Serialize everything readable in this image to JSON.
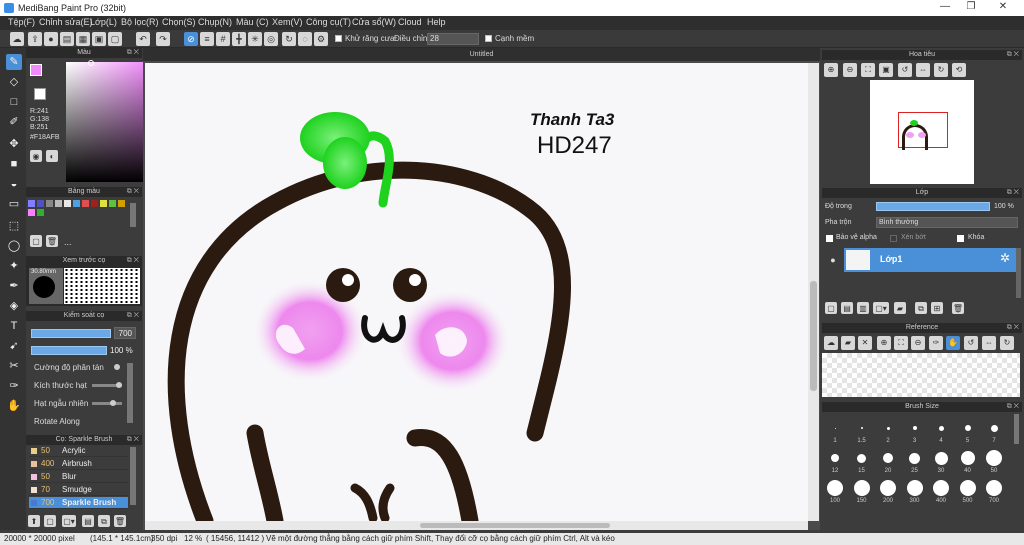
{
  "window": {
    "title": "MediBang Paint Pro (32bit)",
    "minimize": "—",
    "maximize": "❐",
    "close": "✕"
  },
  "menu": [
    "Tệp(F)",
    "Chỉnh sửa(E)",
    "Lớp(L)",
    "Bộ lọc(R)",
    "Chọn(S)",
    "Chụp(N)",
    "Màu (C)",
    "Xem(V)",
    "Công cụ(T)",
    "Cửa sổ(W)",
    "Cloud",
    "Help"
  ],
  "toolbar": {
    "antialias_label": "Khử răng cưa",
    "adjust_label": "Điều chỉnh",
    "adjust_value": "28",
    "edge_label": "Cạnh mềm"
  },
  "color_panel": {
    "title": "Màu",
    "r": "R:241",
    "g": "G:138",
    "b": "B:251",
    "hex": "#F18AFB",
    "fg": "#f18afb",
    "bg": "#ffffff"
  },
  "palette_panel": {
    "title": "Bảng màu",
    "colors": [
      "#7f7fff",
      "#5050c0",
      "#888888",
      "#bbbbbb",
      "#e8e8e8",
      "#50a0e0",
      "#e05050",
      "#a02020",
      "#e0e040",
      "#60c040",
      "#d0a000",
      "#ff80ff",
      "#30b030"
    ],
    "more": "..."
  },
  "preview_panel": {
    "title": "Xem trước cọ",
    "size": "30.80mm"
  },
  "brush_control": {
    "title": "Kiểm soát cọ",
    "size_value": "700",
    "opacity_value": "100 %",
    "props": [
      "Cường độ phân tán",
      "Kích thước hạt",
      "Hạt ngẫu nhiên",
      "Rotate Along"
    ]
  },
  "brush_list": {
    "title": "Cọ: Sparkle Brush",
    "items": [
      {
        "size": "50",
        "name": "Acrylic",
        "color": "#e8d088"
      },
      {
        "size": "400",
        "name": "Airbrush",
        "color": "#e8c0a0"
      },
      {
        "size": "50",
        "name": "Blur",
        "color": "#f0c0e0"
      },
      {
        "size": "70",
        "name": "Smudge",
        "color": "#f0e0d0"
      },
      {
        "size": "700",
        "name": "Sparkle Brush",
        "color": "#4a78d0"
      }
    ]
  },
  "canvas": {
    "title": "Untitled",
    "text1": "Thanh Ta3",
    "text2": "HD247"
  },
  "navigator": {
    "title": "Hoa tiêu"
  },
  "layer_panel": {
    "title": "Lớp",
    "opacity_label": "Độ trong",
    "opacity_value": "100 %",
    "blend_label": "Pha trộn",
    "blend_value": "Bình thường",
    "protect_alpha": "Bảo vệ alpha",
    "clipping": "Xén bớt",
    "lock": "Khóa",
    "layer_name": "Lớp1"
  },
  "reference": {
    "title": "Reference"
  },
  "brush_size": {
    "title": "Brush Size",
    "sizes": [
      "1",
      "1.5",
      "2",
      "3",
      "4",
      "5",
      "7",
      "12",
      "15",
      "20",
      "25",
      "30",
      "40",
      "50",
      "100",
      "150",
      "200",
      "300",
      "400",
      "500",
      "700"
    ]
  },
  "status": {
    "size": "20000 * 20000 pixel",
    "mm": "(145.1 * 145.1cm)",
    "dpi": "350 dpi",
    "zoom": "12 %",
    "coords": "( 15456, 11412 )",
    "hint": "Vẽ một đường thẳng bằng cách giữ phím Shift, Thay đổi cỡ cọ bằng cách giữ phím Ctrl, Alt và kéo"
  }
}
